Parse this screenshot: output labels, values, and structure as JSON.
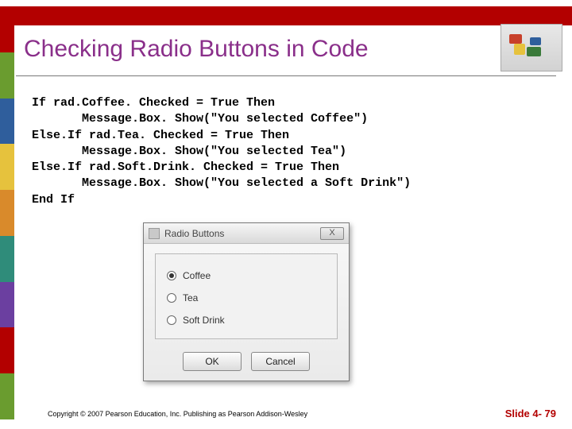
{
  "title": "Checking Radio Buttons in Code",
  "code": "If rad.Coffee. Checked = True Then\n       Message.Box. Show(\"You selected Coffee\")\nElse.If rad.Tea. Checked = True Then\n       Message.Box. Show(\"You selected Tea\")\nElse.If rad.Soft.Drink. Checked = True Then\n       Message.Box. Show(\"You selected a Soft Drink\")\nEnd If",
  "dialog": {
    "title": "Radio Buttons",
    "close_glyph": "X",
    "options": {
      "coffee": "Coffee",
      "tea": "Tea",
      "softdrink": "Soft Drink"
    },
    "buttons": {
      "ok": "OK",
      "cancel": "Cancel"
    }
  },
  "footer": {
    "copyright": "Copyright © 2007 Pearson Education, Inc. Publishing as Pearson Addison-Wesley",
    "slide": "Slide 4- 79"
  }
}
